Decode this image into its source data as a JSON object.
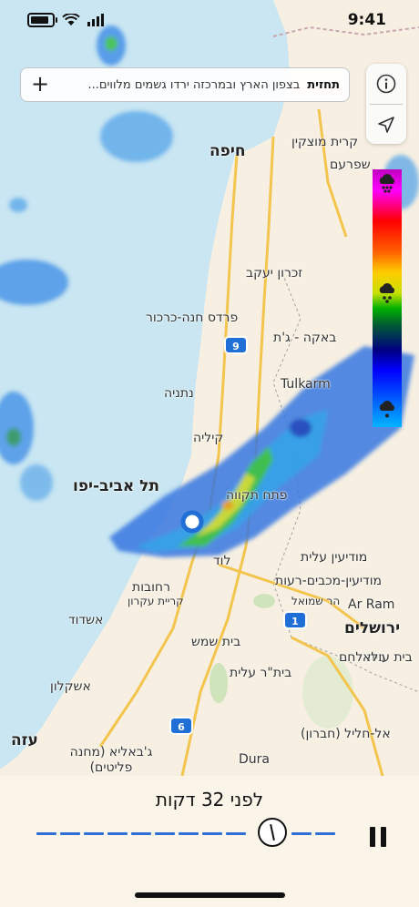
{
  "status_bar": {
    "time": "9:41"
  },
  "forecast": {
    "title": "תחזית",
    "body": "בצפון הארץ ובמרכזה ירדו גשמים מלווים..."
  },
  "map": {
    "places": [
      {
        "id": "kiryat-motzkin",
        "name": "קרית מוצקין",
        "big": false
      },
      {
        "id": "haifa",
        "name": "חיפה",
        "big": true
      },
      {
        "id": "shefaram",
        "name": "שפרעם",
        "big": false
      },
      {
        "id": "zichron",
        "name": "זכרון יעקב",
        "big": false
      },
      {
        "id": "pardes-hana",
        "name": "פרדס חנה-כרכור",
        "big": false
      },
      {
        "id": "baka",
        "name": "באקה - ג'ת",
        "big": false
      },
      {
        "id": "netanya",
        "name": "נתניה",
        "big": false
      },
      {
        "id": "tulkarm",
        "name": "Tulkarm",
        "big": false
      },
      {
        "id": "herzliya",
        "name": "קיליה",
        "big": false
      },
      {
        "id": "tel-aviv",
        "name": "תל אביב-יפו",
        "big": true
      },
      {
        "id": "petah-tikva",
        "name": "פתח תקווה",
        "big": false
      },
      {
        "id": "modiin-ilit",
        "name": "מודיעין עלית",
        "big": false
      },
      {
        "id": "lod",
        "name": "לוד",
        "big": false
      },
      {
        "id": "rehovot",
        "name": "רחובות",
        "big": false
      },
      {
        "id": "modiin",
        "name": "מודיעין-מכבים-רעות",
        "big": false
      },
      {
        "id": "kiryat-ekron",
        "name": "קריית עקרון",
        "big": false
      },
      {
        "id": "har-shmuel",
        "name": "הר שמואל",
        "big": false
      },
      {
        "id": "ar-ram",
        "name": "Ar Ram",
        "big": false
      },
      {
        "id": "ashdod",
        "name": "אשדוד",
        "big": false
      },
      {
        "id": "jerusalem",
        "name": "ירושלים",
        "big": true
      },
      {
        "id": "beit-shemesh",
        "name": "בית שמש",
        "big": false
      },
      {
        "id": "bethlehem",
        "name": "בית לחם",
        "big": false
      },
      {
        "id": "beitar-ilit",
        "name": "בית\"ר עלית",
        "big": false
      },
      {
        "id": "beit-ula",
        "name": "בית עולא",
        "big": false
      },
      {
        "id": "ashkelon",
        "name": "אשקלון",
        "big": false
      },
      {
        "id": "hebron",
        "name": "אל-חליל (חברון)",
        "big": false
      },
      {
        "id": "gaza",
        "name": "עזה",
        "big": true
      },
      {
        "id": "jabalia",
        "name": "ג'באליא (מחנה פליטים)",
        "big": false
      },
      {
        "id": "dura",
        "name": "Dura",
        "big": false
      }
    ],
    "highway_shields": [
      "9",
      "1",
      "6"
    ]
  },
  "legend": {
    "icons": [
      "heavy-rain-icon",
      "rain-icon",
      "drizzle-icon"
    ]
  },
  "timeline": {
    "label": "לפני 32 דקות",
    "pause_icon": "pause-icon"
  },
  "colors": {
    "accent": "#2f6fd6",
    "sea": "#c9e6f2",
    "land": "#f7f0e2",
    "panel": "#fbf4e9"
  }
}
